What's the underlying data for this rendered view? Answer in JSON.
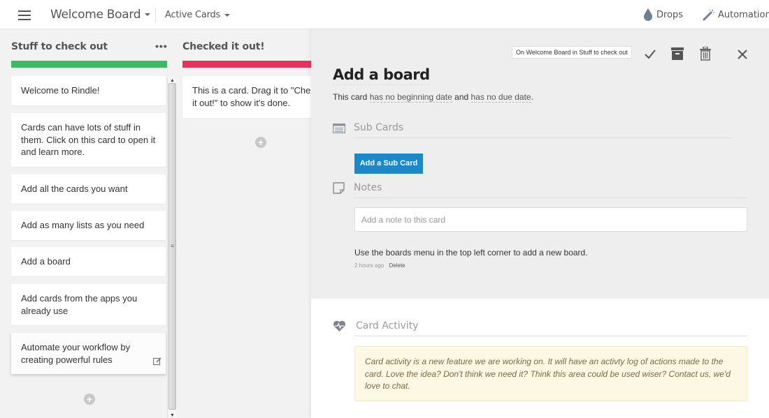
{
  "topbar": {
    "menu_icon": "hamburger-icon",
    "board_title": "Welcome Board",
    "view_filter": "Active Cards",
    "drops_label": "Drops",
    "automation_label": "Automation"
  },
  "lists": [
    {
      "title": "Stuff to check out",
      "menu_label": "•••",
      "color": "#3cbb63",
      "cards": [
        "Welcome to Rindle!",
        "Cards can have lots of stuff in them. Click on this card to open it and learn more.",
        "Add all the cards you want",
        "Add as many lists as you need",
        "Add a board",
        "Add cards from the apps you already use",
        "Automate your workflow by creating powerful rules"
      ]
    },
    {
      "title": "Checked it out!",
      "color": "#e8325e",
      "cards": [
        "This is a card. Drag it to \"Checked it out!\" to show it's done."
      ]
    }
  ],
  "detail": {
    "location": "On Welcome Board in Stuff to check out",
    "title": "Add a board",
    "dates": {
      "prefix": "This card",
      "begin": "has no beginning date",
      "joiner": "and",
      "due": "has no due date",
      "suffix": "."
    },
    "subcards": {
      "title": "Sub Cards",
      "add_button": "Add a Sub Card"
    },
    "notes": {
      "title": "Notes",
      "placeholder": "Add a note to this card",
      "items": [
        {
          "text": "Use the boards menu in the top left corner to add a new board.",
          "time": "2 hours ago",
          "delete_label": "Delete"
        }
      ]
    },
    "activity": {
      "title": "Card Activity",
      "message": "Card activity is a new feature we are working on. It will have an activty log of actions made to the card. Love the idea? Don't think we need it? Think this area could be used wiser? Contact us, we'd love to chat."
    }
  },
  "colors": {
    "accent_blue": "#1a88c9",
    "list1_bar": "#3cbb63",
    "list2_bar": "#e8325e",
    "activity_bg": "#fcf8e3"
  }
}
